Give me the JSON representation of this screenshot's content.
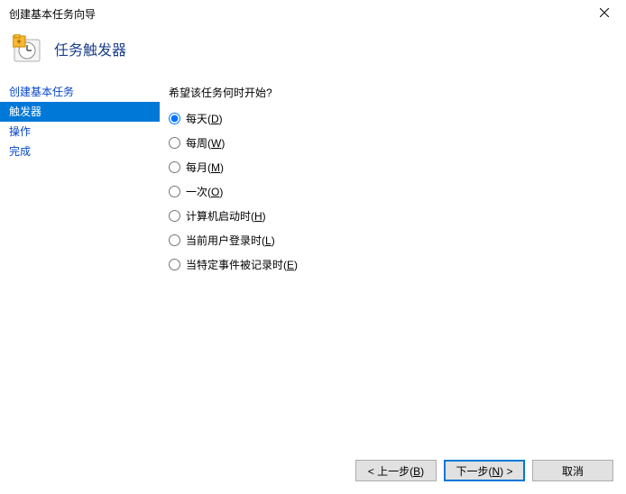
{
  "window": {
    "title": "创建基本任务向导"
  },
  "header": {
    "title": "任务触发器"
  },
  "sidebar": {
    "items": [
      {
        "label": "创建基本任务",
        "selected": false
      },
      {
        "label": "触发器",
        "selected": true
      },
      {
        "label": "操作",
        "selected": false
      },
      {
        "label": "完成",
        "selected": false
      }
    ]
  },
  "content": {
    "prompt": "希望该任务何时开始?",
    "options": [
      {
        "label": "每天",
        "accel": "D",
        "checked": true
      },
      {
        "label": "每周",
        "accel": "W",
        "checked": false
      },
      {
        "label": "每月",
        "accel": "M",
        "checked": false
      },
      {
        "label": "一次",
        "accel": "O",
        "checked": false
      },
      {
        "label": "计算机启动时",
        "accel": "H",
        "checked": false
      },
      {
        "label": "当前用户登录时",
        "accel": "L",
        "checked": false
      },
      {
        "label": "当特定事件被记录时",
        "accel": "E",
        "checked": false
      }
    ]
  },
  "buttons": {
    "back": {
      "prefix": "< 上一步(",
      "accel": "B",
      "suffix": ")"
    },
    "next": {
      "prefix": "下一步(",
      "accel": "N",
      "suffix": ") >"
    },
    "cancel": "取消"
  }
}
